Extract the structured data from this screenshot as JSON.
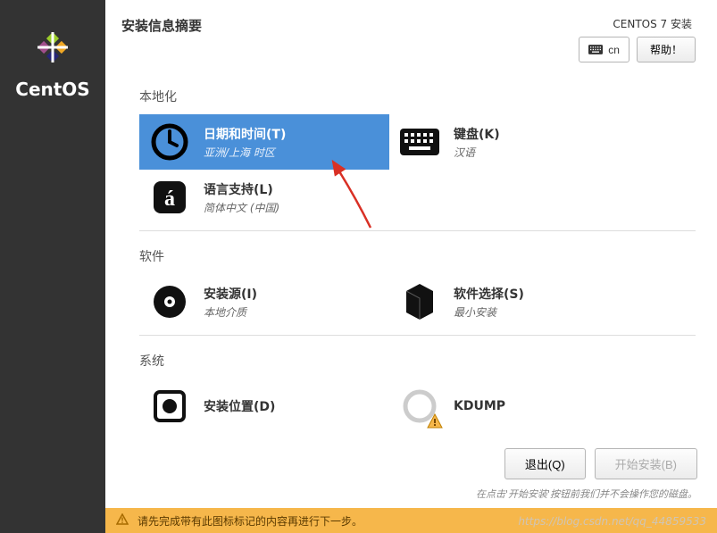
{
  "sidebar": {
    "brand": "CentOS"
  },
  "header": {
    "title": "安装信息摘要",
    "distro": "CENTOS 7 安装",
    "keyboard_layout": "cn",
    "help_label": "帮助！"
  },
  "sections": {
    "localization": {
      "title": "本地化",
      "datetime": {
        "title": "日期和时间(T)",
        "sub": "亚洲/上海 时区"
      },
      "keyboard": {
        "title": "键盘(K)",
        "sub": "汉语"
      },
      "language": {
        "title": "语言支持(L)",
        "sub": "简体中文 (中国)"
      }
    },
    "software": {
      "title": "软件",
      "source": {
        "title": "安装源(I)",
        "sub": "本地介质"
      },
      "selection": {
        "title": "软件选择(S)",
        "sub": "最小安装"
      }
    },
    "system": {
      "title": "系统",
      "destination": {
        "title": "安装位置(D)"
      },
      "kdump": {
        "title": "KDUMP"
      }
    }
  },
  "footer": {
    "quit": "退出(Q)",
    "begin": "开始安装(B)",
    "hint": "在点击'开始安装'按钮前我们并不会操作您的磁盘。"
  },
  "warning": "请先完成带有此图标标记的内容再进行下一步。",
  "watermark": "https://blog.csdn.net/qq_44859533"
}
